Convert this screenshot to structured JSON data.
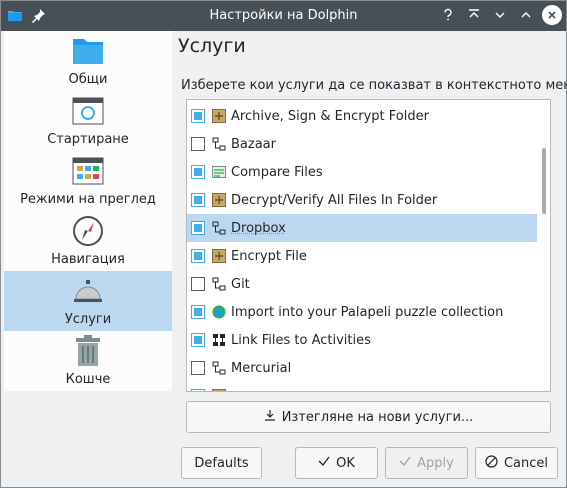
{
  "window": {
    "title": "Настройки на Dolphin"
  },
  "sidebar": {
    "items": [
      {
        "label": "Общи",
        "icon": "folder-icon"
      },
      {
        "label": "Стартиране",
        "icon": "window-startup-icon"
      },
      {
        "label": "Режими на преглед",
        "icon": "view-modes-icon"
      },
      {
        "label": "Навигация",
        "icon": "compass-icon"
      },
      {
        "label": "Услуги",
        "icon": "services-bell-icon"
      },
      {
        "label": "Кошче",
        "icon": "trash-icon"
      }
    ],
    "selected_index": 4
  },
  "main": {
    "title": "Услуги",
    "instruction": "Изберете кои услуги да се показват в контекстното меню:",
    "services": [
      {
        "label": "Archive, Sign & Encrypt Folder",
        "checked": true,
        "icon": "encrypt-package-icon"
      },
      {
        "label": "Bazaar",
        "checked": false,
        "icon": "vcs-icon"
      },
      {
        "label": "Compare Files",
        "checked": true,
        "icon": "compare-icon"
      },
      {
        "label": "Decrypt/Verify All Files In Folder",
        "checked": true,
        "icon": "encrypt-package-icon"
      },
      {
        "label": "Dropbox",
        "checked": true,
        "icon": "vcs-icon",
        "selected": true
      },
      {
        "label": "Encrypt File",
        "checked": true,
        "icon": "encrypt-package-icon"
      },
      {
        "label": "Git",
        "checked": false,
        "icon": "vcs-icon"
      },
      {
        "label": "Import into your Palapeli puzzle collection",
        "checked": true,
        "icon": "palapeli-icon"
      },
      {
        "label": "Link Files to Activities",
        "checked": true,
        "icon": "activities-icon"
      },
      {
        "label": "Mercurial",
        "checked": false,
        "icon": "vcs-icon"
      },
      {
        "label": "",
        "checked": true,
        "icon": "encrypt-package-icon"
      }
    ],
    "download_button": "Изтегляне на нови услуги..."
  },
  "buttons": {
    "defaults": "Defaults",
    "ok": "OK",
    "apply": "Apply",
    "cancel": "Cancel"
  },
  "colors": {
    "accent": "#3daee9",
    "selection": "#bcd8f1",
    "titlebar": "#475057"
  }
}
